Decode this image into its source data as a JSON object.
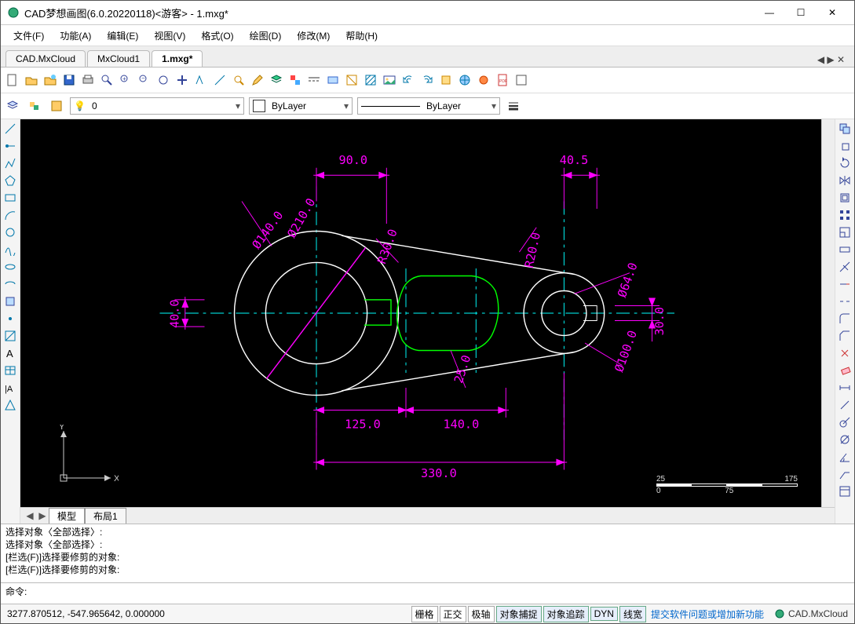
{
  "title": "CAD梦想画图(6.0.20220118)<游客> - 1.mxg*",
  "menu": [
    "文件(F)",
    "功能(A)",
    "编辑(E)",
    "视图(V)",
    "格式(O)",
    "绘图(D)",
    "修改(M)",
    "帮助(H)"
  ],
  "tabs": {
    "items": [
      "CAD.MxCloud",
      "MxCloud1",
      "1.mxg*"
    ],
    "active": 2
  },
  "layer": {
    "current": "0"
  },
  "color_label": "ByLayer",
  "linetype_label": "ByLayer",
  "model_tabs": {
    "items": [
      "模型",
      "布局1"
    ],
    "active": 0
  },
  "command_history": [
    "选择对象〈全部选择〉:",
    "选择对象〈全部选择〉:",
    "[栏选(F)]选择要修剪的对象:",
    "[栏选(F)]选择要修剪的对象:"
  ],
  "prompt_label": "命令:",
  "coords": "3277.870512,  -547.965642,  0.000000",
  "status_toggles": [
    {
      "label": "栅格",
      "on": false
    },
    {
      "label": "正交",
      "on": false
    },
    {
      "label": "极轴",
      "on": false
    },
    {
      "label": "对象捕捉",
      "on": true
    },
    {
      "label": "对象追踪",
      "on": true
    },
    {
      "label": "DYN",
      "on": true
    },
    {
      "label": "线宽",
      "on": true
    }
  ],
  "status_link": "提交软件问题或增加新功能",
  "brand": "CAD.MxCloud",
  "scalebar": {
    "top": [
      "25",
      "175"
    ],
    "bottom": [
      "0",
      "75"
    ]
  },
  "axes": {
    "x": "X",
    "y": "Y"
  },
  "drawing": {
    "dims": {
      "d90": "90.0",
      "d40_5": "40.5",
      "d125": "125.0",
      "d140": "140.0",
      "d330": "330.0",
      "d40": "40.0",
      "d30": "30.0",
      "d25": "25.0"
    },
    "dia": {
      "p210": "Ø210.0",
      "p140": "Ø140.0",
      "p100": "Ø100.0",
      "p64": "Ø64.0"
    },
    "rad": {
      "r30": "R30.0",
      "r20": "R20.0"
    }
  }
}
